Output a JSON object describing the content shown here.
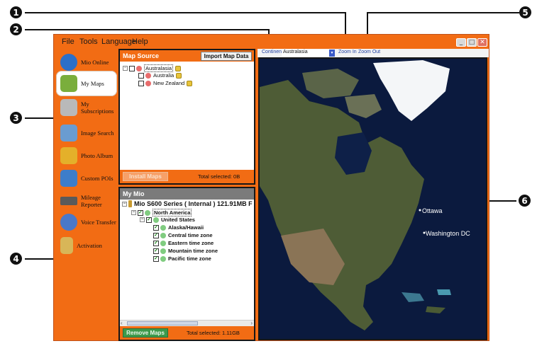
{
  "callouts": [
    "1",
    "2",
    "3",
    "4",
    "5",
    "6"
  ],
  "menu": [
    "File",
    "Tools",
    "Language",
    "Help"
  ],
  "window_buttons": {
    "minimize": "_",
    "maximize": "□",
    "close": "✕"
  },
  "sidebar": {
    "items": [
      {
        "label": "Mio Online",
        "icon": "globe-icon",
        "color": "#2c6fc8"
      },
      {
        "label": "My Maps",
        "icon": "maps-icon",
        "color": "#7aae3c",
        "active": true
      },
      {
        "label": "My Subscriptions",
        "icon": "subscriptions-icon",
        "color": "#b9b9b9"
      },
      {
        "label": "Image Search",
        "icon": "image-search-icon",
        "color": "#6a9cd0"
      },
      {
        "label": "Photo Album",
        "icon": "photo-album-icon",
        "color": "#e4b02a"
      },
      {
        "label": "Custom POIs",
        "icon": "custom-pois-icon",
        "color": "#3d7dca"
      },
      {
        "label": "Mileage Reporter",
        "icon": "mileage-reporter-icon",
        "color": "#5a5a5a"
      },
      {
        "label": "Voice Transfer",
        "icon": "voice-transfer-icon",
        "color": "#4a78c8"
      },
      {
        "label": "Activation",
        "icon": "activation-icon",
        "color": "#d8b658"
      }
    ]
  },
  "map_source": {
    "title": "Map Source",
    "import_button": "Import Map Data",
    "tree": [
      {
        "label": "Australasia",
        "level": 0
      },
      {
        "label": "Australia",
        "level": 1
      },
      {
        "label": "New Zealand",
        "level": 1
      }
    ],
    "install_button": "Install Maps",
    "total": "Total selected: 0B"
  },
  "my_mio": {
    "title": "My Mio",
    "device": "Mio S600 Series ( Internal ) 121.91MB F",
    "tree": [
      {
        "label": "North America",
        "level": 1
      },
      {
        "label": "United States",
        "level": 2
      },
      {
        "label": "Alaska/Hawaii",
        "level": 3
      },
      {
        "label": "Central time zone",
        "level": 3
      },
      {
        "label": "Eastern time zone",
        "level": 3
      },
      {
        "label": "Mountain time zone",
        "level": 3
      },
      {
        "label": "Pacific time zone",
        "level": 3
      }
    ],
    "remove_button": "Remove Maps",
    "total": "Total selected: 1.11GB"
  },
  "map_toolbar": {
    "continent_label": "Continent",
    "continent_value": "Australasia",
    "zoom_in": "Zoom In",
    "zoom_out": "Zoom Out"
  },
  "map_labels": {
    "city1": "Ottawa",
    "city2": "Washington DC"
  },
  "colors": {
    "accent": "#f26c14",
    "ocean": "#0b1a3e",
    "land": "#4a5a34"
  }
}
